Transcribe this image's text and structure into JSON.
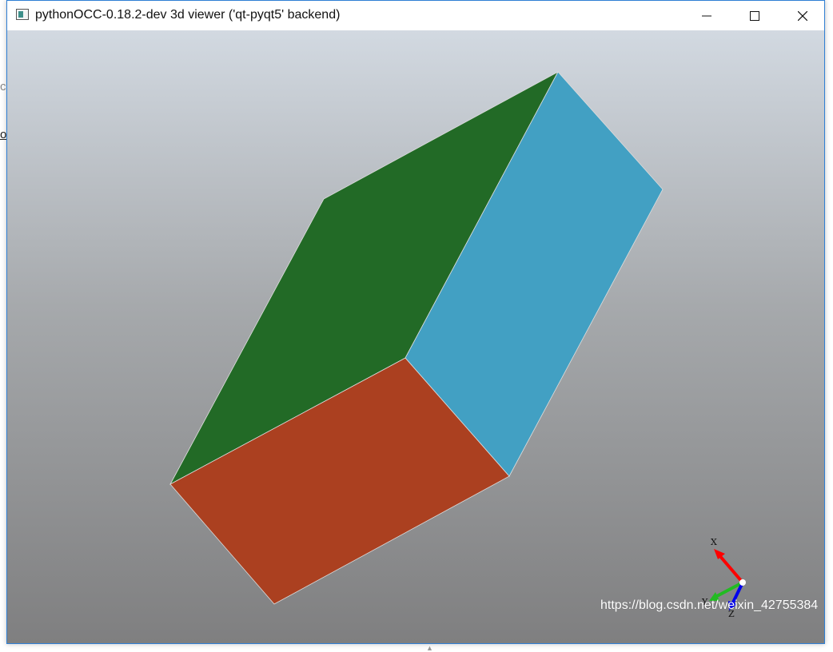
{
  "window": {
    "title": "pythonOCC-0.18.2-dev 3d viewer ('qt-pyqt5' backend)",
    "buttons": {
      "minimize": "minimize-icon",
      "maximize": "maximize-icon",
      "close": "close-icon"
    }
  },
  "viewer": {
    "background_top": "#d2d9e1",
    "background_bottom": "#7f7f80",
    "faces": [
      {
        "name": "top-face",
        "color": "#226a26"
      },
      {
        "name": "right-face",
        "color": "#42a0c3"
      },
      {
        "name": "front-face",
        "color": "#ab4020"
      }
    ],
    "triedron": {
      "x_label": "X",
      "y_label": "Y",
      "z_label": "Z",
      "x_color": "#ff0000",
      "y_color": "#22bb22",
      "z_color": "#0000ee"
    }
  },
  "watermark": "https://blog.csdn.net/weixin_42755384"
}
